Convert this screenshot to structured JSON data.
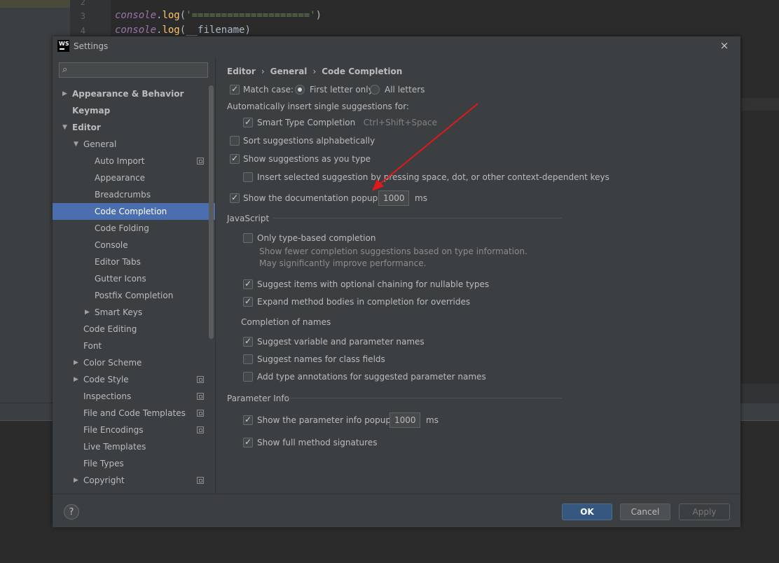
{
  "editor": {
    "lines": [
      {
        "num": "2"
      },
      {
        "num": "3",
        "obj": "console",
        "dot": ".",
        "fn": "log",
        "open": "(",
        "str": "'===================='",
        "close": ")"
      },
      {
        "num": "4",
        "obj": "console",
        "dot": ".",
        "fn": "log",
        "open": "(",
        "arg": "__filename",
        "close": ")"
      }
    ]
  },
  "dialog": {
    "title": "Settings",
    "logo_text": "WS",
    "close_icon": "×"
  },
  "search": {
    "icon": "⌕",
    "placeholder": ""
  },
  "tree": {
    "items": [
      {
        "label": "Appearance & Behavior",
        "arrow": "▶",
        "bold": true
      },
      {
        "label": "Keymap",
        "bold": true
      },
      {
        "label": "Editor",
        "arrow": "▼",
        "bold": true
      },
      {
        "label": "General",
        "arrow": "▼"
      },
      {
        "label": "Auto Import",
        "copy": true
      },
      {
        "label": "Appearance"
      },
      {
        "label": "Breadcrumbs"
      },
      {
        "label": "Code Completion",
        "selected": true
      },
      {
        "label": "Code Folding"
      },
      {
        "label": "Console"
      },
      {
        "label": "Editor Tabs"
      },
      {
        "label": "Gutter Icons"
      },
      {
        "label": "Postfix Completion"
      },
      {
        "label": "Smart Keys",
        "arrow": "▶"
      },
      {
        "label": "Code Editing"
      },
      {
        "label": "Font"
      },
      {
        "label": "Color Scheme",
        "arrow": "▶"
      },
      {
        "label": "Code Style",
        "arrow": "▶",
        "copy": true
      },
      {
        "label": "Inspections",
        "copy": true
      },
      {
        "label": "File and Code Templates",
        "copy": true
      },
      {
        "label": "File Encodings",
        "copy": true
      },
      {
        "label": "Live Templates"
      },
      {
        "label": "File Types"
      },
      {
        "label": "Copyright",
        "arrow": "▶",
        "copy": true
      }
    ]
  },
  "breadcrumb": {
    "items": [
      "Editor",
      "General",
      "Code Completion"
    ],
    "separator": "›"
  },
  "options": {
    "match_case": {
      "label": "Match case:",
      "checked": true
    },
    "first_letter": {
      "label": "First letter only",
      "selected": true
    },
    "all_letters": {
      "label": "All letters",
      "selected": false
    },
    "auto_insert_label": "Automatically insert single suggestions for:",
    "smart_type": {
      "label": "Smart Type Completion",
      "shortcut": "Ctrl+Shift+Space",
      "checked": true
    },
    "sort_alpha": {
      "label": "Sort suggestions alphabetically",
      "checked": false
    },
    "show_as_type": {
      "label": "Show suggestions as you type",
      "checked": true
    },
    "insert_selected": {
      "label": "Insert selected suggestion by pressing space, dot, or other context-dependent keys",
      "checked": false
    },
    "doc_popup": {
      "label": "Show the documentation popup in",
      "value": "1000",
      "unit": "ms",
      "checked": true
    }
  },
  "javascript": {
    "section": "JavaScript",
    "only_type": {
      "label": "Only type-based completion",
      "checked": false
    },
    "only_type_desc": "Show fewer completion suggestions based on type information. May significantly improve performance.",
    "optional_chaining": {
      "label": "Suggest items with optional chaining for nullable types",
      "checked": true
    },
    "expand_method": {
      "label": "Expand method bodies in completion for overrides",
      "checked": true
    },
    "names_section": "Completion of names",
    "var_names": {
      "label": "Suggest variable and parameter names",
      "checked": true
    },
    "class_fields": {
      "label": "Suggest names for class fields",
      "checked": false
    },
    "type_annotations": {
      "label": "Add type annotations for suggested parameter names",
      "checked": false
    }
  },
  "param_info": {
    "section": "Parameter Info",
    "popup": {
      "label": "Show the parameter info popup in",
      "value": "1000",
      "unit": "ms",
      "checked": true
    },
    "full_sig": {
      "label": "Show full method signatures",
      "checked": true
    }
  },
  "footer": {
    "help": "?",
    "ok": "OK",
    "cancel": "Cancel",
    "apply": "Apply"
  },
  "colors": {
    "accent": "#4b6eaf",
    "arrow": "#e0191a",
    "ok_button": "#365880"
  }
}
